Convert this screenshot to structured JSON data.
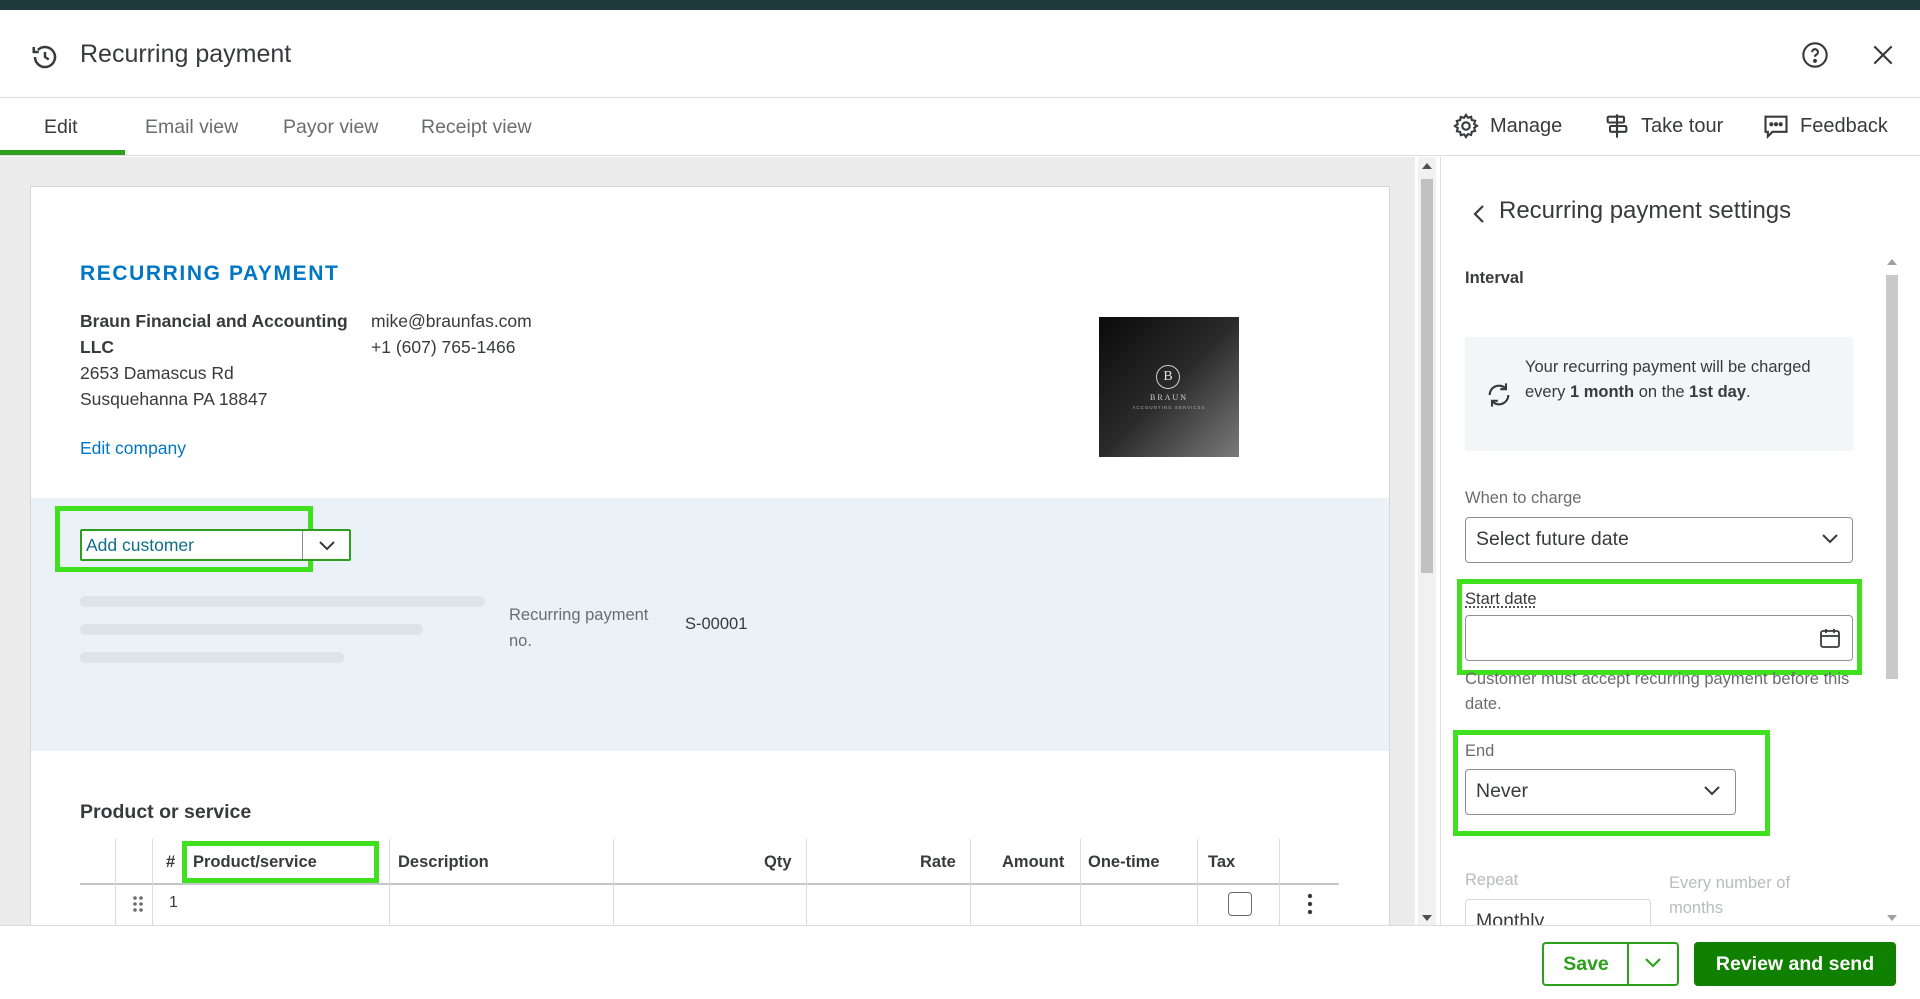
{
  "header": {
    "title": "Recurring payment"
  },
  "tabs": [
    {
      "label": "Edit"
    },
    {
      "label": "Email view"
    },
    {
      "label": "Payor view"
    },
    {
      "label": "Receipt view"
    }
  ],
  "tools": {
    "manage": "Manage",
    "take_tour": "Take tour",
    "feedback": "Feedback"
  },
  "document": {
    "title": "RECURRING PAYMENT",
    "company": {
      "name": "Braun Financial and Accounting LLC",
      "address_line1": "2653 Damascus Rd",
      "address_line2": "Susquehanna PA 18847",
      "email": "mike@braunfas.com",
      "phone": "+1 (607) 765-1466"
    },
    "edit_company": "Edit company",
    "logo": {
      "letter": "B",
      "name": "BRAUN",
      "sub": "ACCOUNTING SERVICES"
    },
    "customer_select": {
      "value": "Add customer"
    },
    "recurring_no_label": "Recurring payment no.",
    "recurring_no_value": "S-00001",
    "products_title": "Product or service",
    "table": {
      "headers": [
        "#",
        "Product/service",
        "Description",
        "Qty",
        "Rate",
        "Amount",
        "One-time",
        "Tax"
      ],
      "rows": [
        {
          "num": "1"
        }
      ]
    }
  },
  "panel": {
    "title": "Recurring payment settings",
    "interval_label": "Interval",
    "info": {
      "part1": "Your recurring payment will be charged every ",
      "bold1": "1 month",
      "part2": " on the ",
      "bold2": "1st day",
      "part3": "."
    },
    "when_to_charge": {
      "label": "When to charge",
      "value": "Select future date"
    },
    "start_date": {
      "label": "Start date",
      "value": ""
    },
    "help_text": "Customer must accept recurring payment before this date.",
    "end": {
      "label": "End",
      "value": "Never"
    },
    "repeat": {
      "label": "Repeat",
      "every_label": "Every number of months",
      "value": "Monthly"
    }
  },
  "footer": {
    "save": "Save",
    "review_send": "Review and send"
  },
  "colors": {
    "green": "#2ca01c",
    "dark_green": "#108000",
    "link_blue": "#0077c5",
    "highlight": "#3fe11e"
  }
}
